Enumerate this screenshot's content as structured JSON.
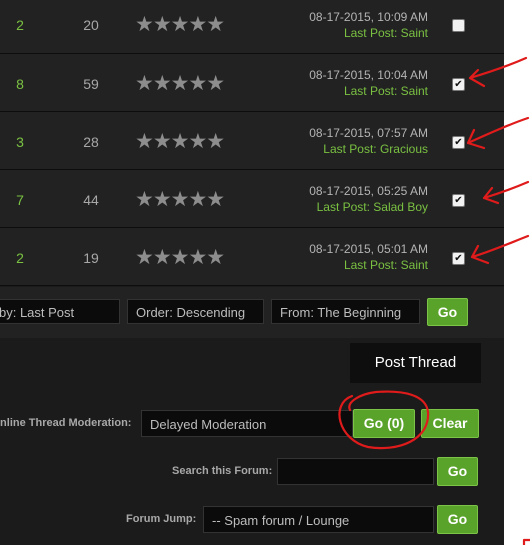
{
  "rows": [
    {
      "replies": "2",
      "views": "20",
      "stars": "★★★★★",
      "date": "08-17-2015, 10:09 AM",
      "last_post": "Last Post: Saint",
      "checked": false
    },
    {
      "replies": "8",
      "views": "59",
      "stars": "★★★★★",
      "date": "08-17-2015, 10:04 AM",
      "last_post": "Last Post: Saint",
      "checked": true
    },
    {
      "replies": "3",
      "views": "28",
      "stars": "★★★★★",
      "date": "08-17-2015, 07:57 AM",
      "last_post": "Last Post: Gracious",
      "checked": true
    },
    {
      "replies": "7",
      "views": "44",
      "stars": "★★★★★",
      "date": "08-17-2015, 05:25 AM",
      "last_post": "Last Post: Salad Boy",
      "checked": true
    },
    {
      "replies": "2",
      "views": "19",
      "stars": "★★★★★",
      "date": "08-17-2015, 05:01 AM",
      "last_post": "Last Post: Saint",
      "checked": true
    }
  ],
  "sort": {
    "sort_by": "by: Last Post",
    "order": "Order: Descending",
    "from": "From: The Beginning",
    "go_label": "Go"
  },
  "post_thread_label": "Post Thread",
  "moderation": {
    "label": "Inline Thread Moderation:",
    "value": "Delayed Moderation",
    "go_label": "Go (0)",
    "clear_label": "Clear"
  },
  "search": {
    "label": "Search this Forum:",
    "value": "",
    "go_label": "Go"
  },
  "jump": {
    "label": "Forum Jump:",
    "value": "-- Spam forum / Lounge",
    "go_label": "Go"
  },
  "colors": {
    "accent_green": "#5aa32a",
    "link_green": "#7ac142",
    "annotation_red": "#e01b1b"
  }
}
